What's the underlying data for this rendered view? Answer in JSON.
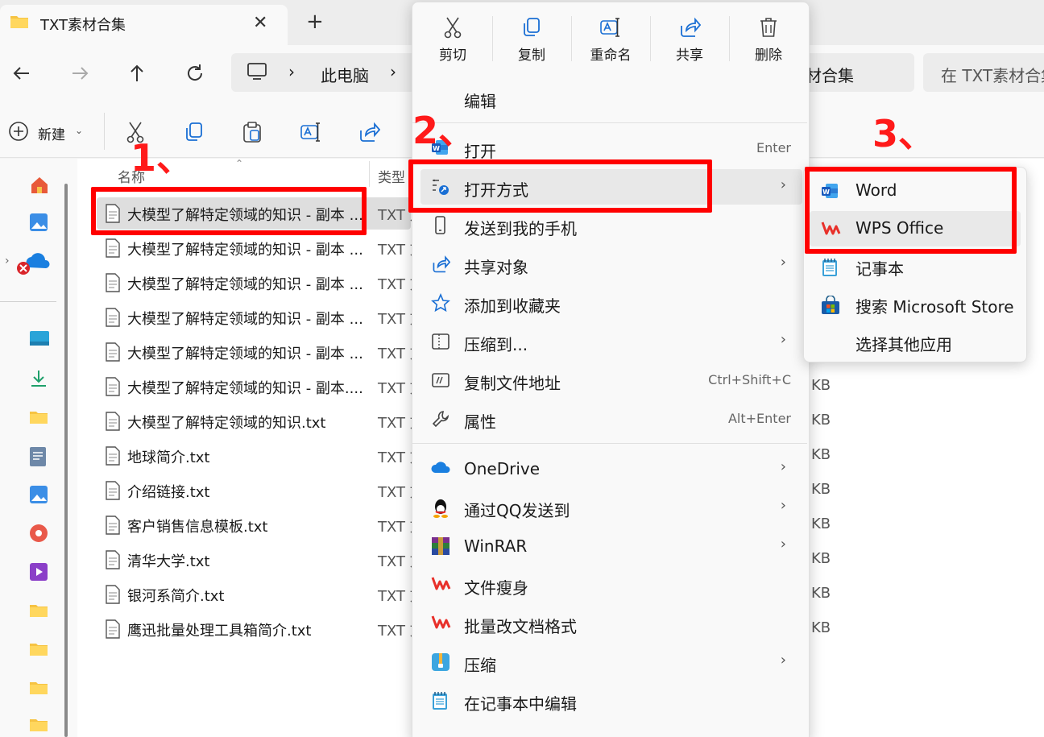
{
  "window": {
    "tab_title": "TXT素材合集",
    "tab_close": "✕",
    "new_tab": "+"
  },
  "address": {
    "path": [
      "此电脑",
      "材合集"
    ],
    "separator": "›",
    "search_placeholder": "在 TXT素材合集"
  },
  "toolbar": {
    "new_label": "新建",
    "new_caret": "⌄",
    "buttons": [
      "cut-icon",
      "copy-icon",
      "paste-icon",
      "rename-icon",
      "share-icon"
    ]
  },
  "columns": {
    "name": "名称",
    "type": "类型"
  },
  "files": [
    {
      "name": "大模型了解特定领域的知识 - 副本 ...",
      "type": "TXT 文",
      "size": ""
    },
    {
      "name": "大模型了解特定领域的知识 - 副本 ...",
      "type": "TXT 文",
      "size": ""
    },
    {
      "name": "大模型了解特定领域的知识 - 副本 ...",
      "type": "TXT 文",
      "size": ""
    },
    {
      "name": "大模型了解特定领域的知识 - 副本 ...",
      "type": "TXT 文",
      "size": ""
    },
    {
      "name": "大模型了解特定领域的知识 - 副本 ...",
      "type": "TXT 文",
      "size": ""
    },
    {
      "name": "大模型了解特定领域的知识 - 副本....",
      "type": "TXT 文",
      "size": "KB"
    },
    {
      "name": "大模型了解特定领域的知识.txt",
      "type": "TXT 文",
      "size": "KB"
    },
    {
      "name": "地球简介.txt",
      "type": "TXT 文",
      "size": "KB"
    },
    {
      "name": "介绍链接.txt",
      "type": "TXT 文",
      "size": "KB"
    },
    {
      "name": "客户销售信息模板.txt",
      "type": "TXT 文",
      "size": "KB"
    },
    {
      "name": "清华大学.txt",
      "type": "TXT 文",
      "size": "KB"
    },
    {
      "name": "银河系简介.txt",
      "type": "TXT 文",
      "size": "KB"
    },
    {
      "name": "鹰迅批量处理工具箱简介.txt",
      "type": "TXT 文",
      "size": "KB"
    }
  ],
  "context_menu": {
    "quick_actions": [
      "剪切",
      "复制",
      "重命名",
      "共享",
      "删除"
    ],
    "edit": "编辑",
    "items": [
      {
        "label": "打开",
        "shortcut": "Enter",
        "icon": "word-icon"
      },
      {
        "label": "打开方式",
        "shortcut": "",
        "icon": "open-with-icon",
        "arrow": "›"
      },
      {
        "label": "发送到我的手机",
        "shortcut": "",
        "icon": "phone-icon"
      },
      {
        "label": "共享对象",
        "shortcut": "",
        "icon": "share-icon",
        "arrow": "›"
      },
      {
        "label": "添加到收藏夹",
        "shortcut": "",
        "icon": "star-icon"
      },
      {
        "label": "压缩到...",
        "shortcut": "",
        "icon": "zip-icon",
        "arrow": "›"
      },
      {
        "label": "复制文件地址",
        "shortcut": "Ctrl+Shift+C",
        "icon": "copy-path-icon"
      },
      {
        "label": "属性",
        "shortcut": "Alt+Enter",
        "icon": "wrench-icon"
      },
      {
        "label": "OneDrive",
        "shortcut": "",
        "icon": "onedrive-icon",
        "arrow": "›"
      },
      {
        "label": "通过QQ发送到",
        "shortcut": "",
        "icon": "qq-icon",
        "arrow": "›"
      },
      {
        "label": "WinRAR",
        "shortcut": "",
        "icon": "winrar-icon",
        "arrow": "›"
      },
      {
        "label": "文件瘦身",
        "shortcut": "",
        "icon": "wps-icon"
      },
      {
        "label": "批量改文档格式",
        "shortcut": "",
        "icon": "wps-icon"
      },
      {
        "label": "压缩",
        "shortcut": "",
        "icon": "compress-icon",
        "arrow": "›"
      },
      {
        "label": "在记事本中编辑",
        "shortcut": "",
        "icon": "notepad-icon"
      }
    ]
  },
  "submenu": {
    "items": [
      "Word",
      "WPS Office",
      "记事本",
      "搜索 Microsoft Store",
      "选择其他应用"
    ]
  },
  "annotations": {
    "step1": "1、",
    "step2": "2、",
    "step3": "3、",
    "color": "#ff0000"
  }
}
